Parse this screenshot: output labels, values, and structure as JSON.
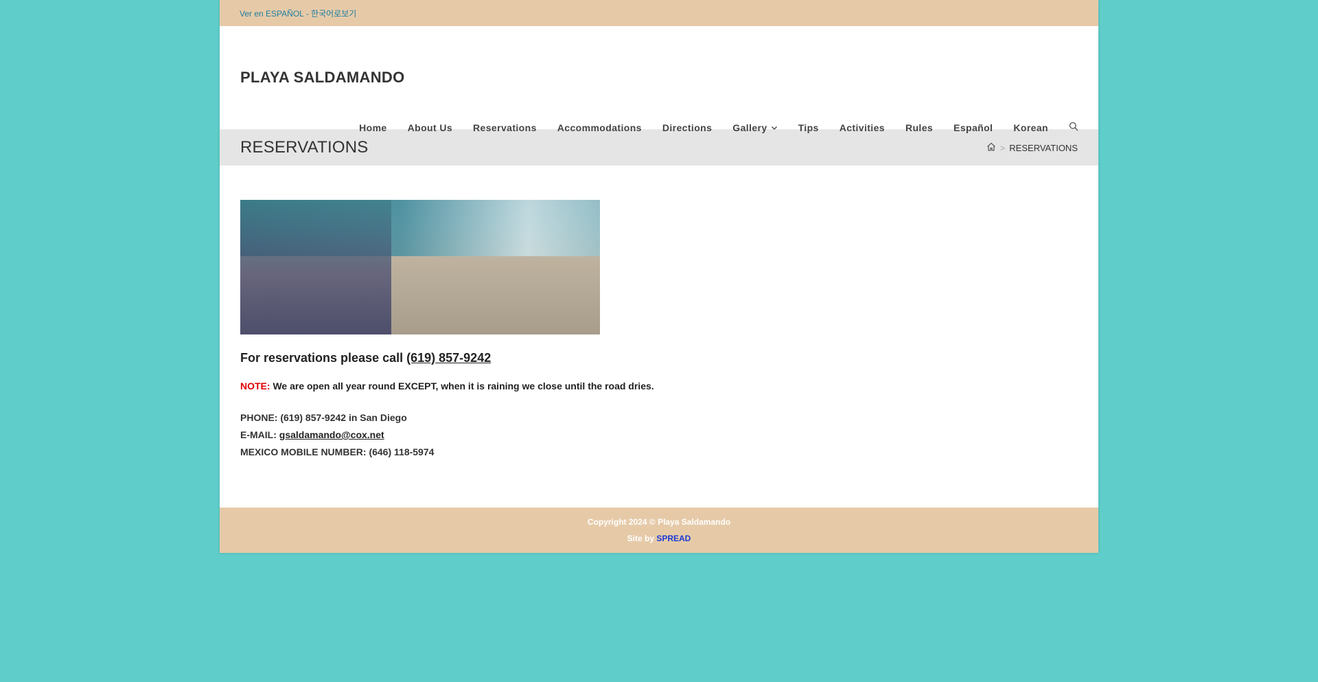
{
  "topbar": {
    "text": "Ver en ESPAÑOL - 한국어로보기"
  },
  "header": {
    "logo": "PLAYA SALDAMANDO"
  },
  "nav": {
    "items": [
      {
        "label": "Home"
      },
      {
        "label": "About Us"
      },
      {
        "label": "Reservations"
      },
      {
        "label": "Accommodations"
      },
      {
        "label": "Directions"
      },
      {
        "label": "Gallery"
      },
      {
        "label": "Tips"
      },
      {
        "label": "Activities"
      },
      {
        "label": "Rules"
      },
      {
        "label": "Español"
      },
      {
        "label": "Korean"
      }
    ],
    "search_icon": "search-icon",
    "gallery_icon": "chevron-down-icon"
  },
  "title_bar": {
    "title": "RESERVATIONS",
    "breadcrumb_home_icon": "home-icon",
    "breadcrumb_separator": ">",
    "breadcrumb_current": "RESERVATIONS"
  },
  "content": {
    "call_text": "For reservations please call ",
    "call_phone": "(619) 857-9242",
    "note_label": "NOTE:",
    "note_text": " We are open all year round EXCEPT, when it is raining we close until the road dries.",
    "phone_line": "PHONE: (619) 857-9242 in San Diego",
    "email_label": "E-MAIL: ",
    "email": "gsaldamando@cox.net",
    "mobile_line": "MEXICO MOBILE NUMBER: (646) 118-5974"
  },
  "footer": {
    "copyright": "Copyright 2024 © Playa Saldamando",
    "site_by_label": "Site by ",
    "site_by_link": "SPREAD"
  },
  "colors": {
    "page_background": "#5fcdc9",
    "topbar_footer": "#e6caa8",
    "note_red": "#e00000",
    "link_blue": "#1a3ad6",
    "topbar_link": "#1e7ea0"
  }
}
